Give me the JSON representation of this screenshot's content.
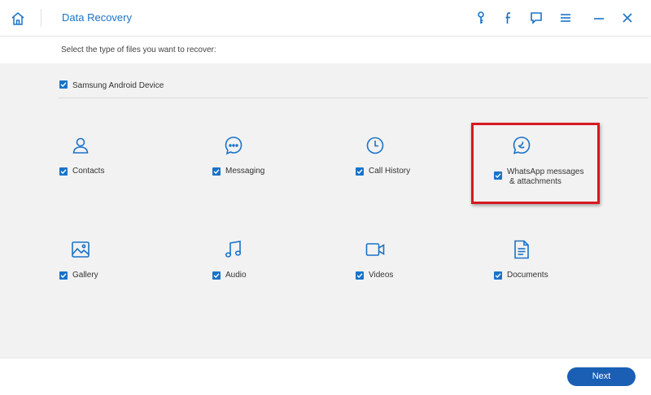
{
  "titlebar": {
    "title": "Data Recovery",
    "icons": [
      "home-icon",
      "key-icon",
      "facebook-icon",
      "chat-icon",
      "menu-icon",
      "minimize-icon",
      "close-icon"
    ]
  },
  "instruction": "Select the type of files you want to recover:",
  "device": {
    "label": "Samsung Android Device",
    "checked": true
  },
  "file_types": [
    {
      "label": "Contacts",
      "icon": "contacts-icon",
      "checked": true
    },
    {
      "label": "Messaging",
      "icon": "messaging-icon",
      "checked": true
    },
    {
      "label": "Call History",
      "icon": "call-history-icon",
      "checked": true
    },
    {
      "label_line1": "WhatsApp messages",
      "label_line2": "& attachments",
      "icon": "whatsapp-icon",
      "checked": true,
      "highlighted": true
    },
    {
      "label": "Gallery",
      "icon": "gallery-icon",
      "checked": true
    },
    {
      "label": "Audio",
      "icon": "audio-icon",
      "checked": true
    },
    {
      "label": "Videos",
      "icon": "videos-icon",
      "checked": true
    },
    {
      "label": "Documents",
      "icon": "documents-icon",
      "checked": true
    }
  ],
  "footer": {
    "next_label": "Next"
  },
  "colors": {
    "accent": "#1a73c8",
    "button": "#1a5fb4",
    "highlight": "#d71920",
    "panel": "#f2f2f2"
  }
}
